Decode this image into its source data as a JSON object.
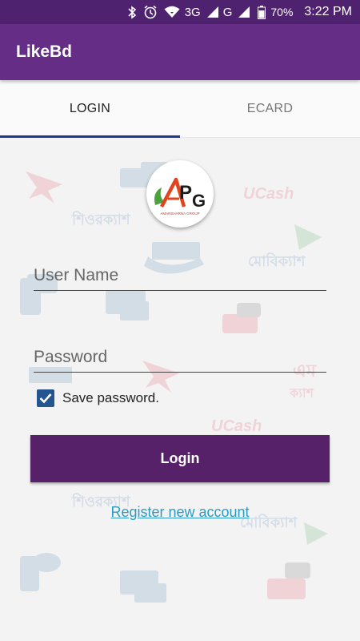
{
  "status_bar": {
    "network_3g": "3G",
    "network_g": "G",
    "battery": "70%",
    "time": "3:22 PM"
  },
  "app": {
    "title": "LikeBd"
  },
  "tabs": [
    {
      "label": "LOGIN",
      "active": true
    },
    {
      "label": "ECARD",
      "active": false
    }
  ],
  "logo": {
    "text": "APG",
    "subtext": "AMARSHARNA GROUP"
  },
  "form": {
    "username_placeholder": "User Name",
    "username_value": "",
    "password_placeholder": "Password",
    "password_value": "",
    "save_password_label": "Save password.",
    "save_password_checked": true,
    "login_label": "Login",
    "register_label": "Register new account"
  },
  "colors": {
    "status_bar": "#4f2270",
    "app_bar": "#652d86",
    "tab_indicator": "#24398a",
    "login_button": "#562168",
    "link": "#2a9bc4",
    "checkbox": "#24558f"
  }
}
